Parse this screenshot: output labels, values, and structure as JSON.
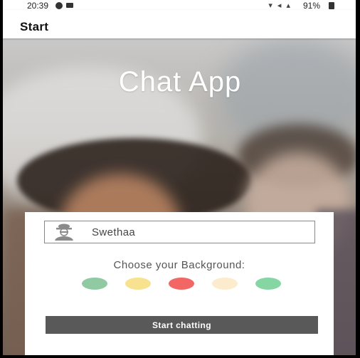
{
  "status_bar": {
    "time": "20:39",
    "battery": "91%"
  },
  "app_bar": {
    "title": "Start"
  },
  "hero": {
    "title": "Chat App"
  },
  "form": {
    "name_value": "Swethaa",
    "choose_label": "Choose your Background:",
    "background_colors": [
      "#8fcaa3",
      "#f8e28f",
      "#f26663",
      "#fdebcd",
      "#86d6a4"
    ],
    "start_label": "Start chatting"
  },
  "colors": {
    "button": "#595959",
    "title_text": "#ffffff"
  },
  "icons": {
    "avatar": "user-avatar-icon"
  }
}
